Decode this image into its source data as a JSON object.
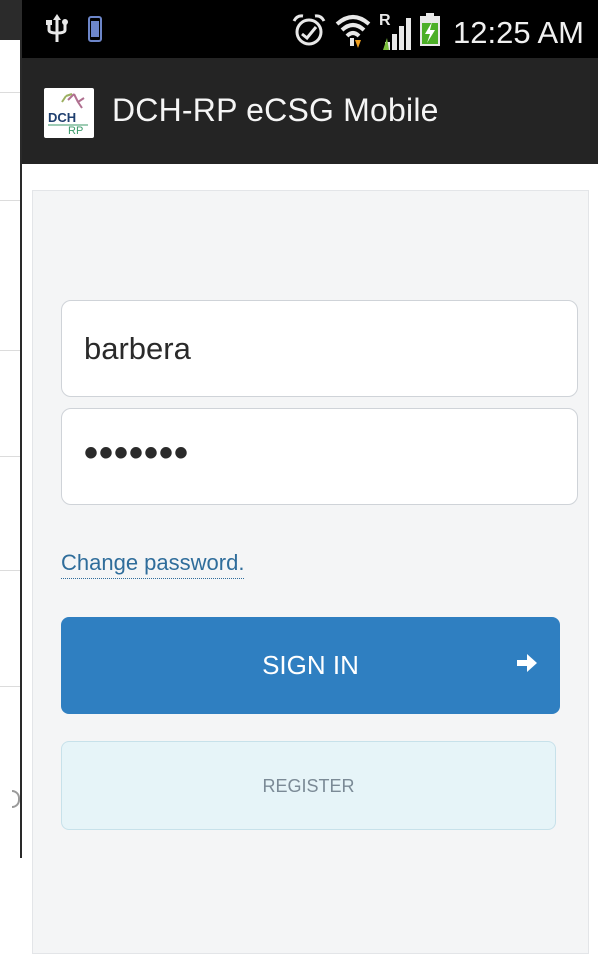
{
  "status_bar": {
    "time": "12:25 AM",
    "roaming_indicator": "R",
    "icons": [
      "usb-icon",
      "phone-storage-icon",
      "alarm-icon",
      "wifi-icon",
      "signal-icon",
      "battery-charging-icon"
    ]
  },
  "app_bar": {
    "title": "DCH-RP eCSG Mobile",
    "logo_text_top": "DCH",
    "logo_text_bottom": "RP"
  },
  "login_form": {
    "username_value": "barbera",
    "password_value": "•••••••",
    "change_password_label": "Change password.",
    "sign_in_label": "SIGN IN",
    "register_label": "REGISTER"
  },
  "colors": {
    "primary": "#2f7fc1",
    "register_bg": "#e6f4f8",
    "link": "#2f6d9b",
    "app_bar": "#242424"
  }
}
